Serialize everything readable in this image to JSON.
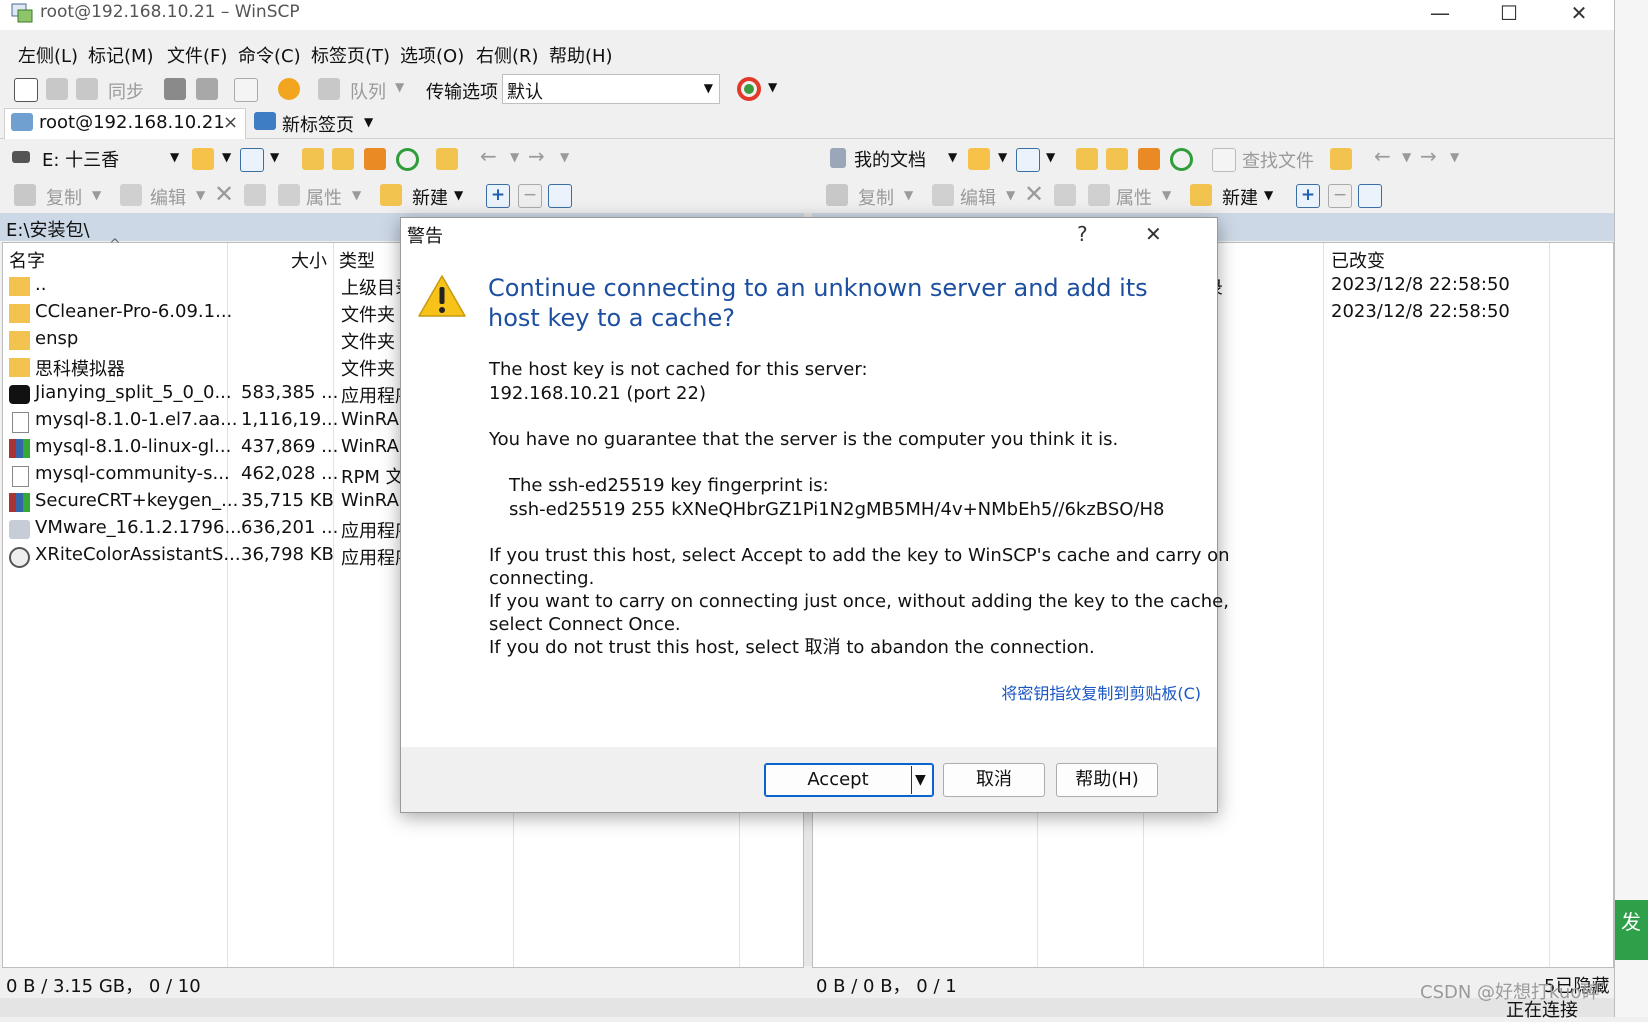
{
  "window": {
    "title": "root@192.168.10.21 – WinSCP",
    "minimize": "—",
    "maximize": "☐",
    "close": "✕"
  },
  "menu": [
    "左侧(L)",
    "标记(M)",
    "文件(F)",
    "命令(C)",
    "标签页(T)",
    "选项(O)",
    "右侧(R)",
    "帮助(H)"
  ],
  "toolbar": {
    "sync": "同步",
    "queue": "队列",
    "transfer_label": "传输选项",
    "transfer_value": "默认"
  },
  "tabs": {
    "session": "root@192.168.10.21",
    "session_close": "×",
    "new_tab": "新标签页"
  },
  "left_panel": {
    "drive": "E: 十三香",
    "actions": {
      "copy": "复制",
      "edit": "编辑",
      "properties": "属性",
      "new": "新建"
    },
    "path": "E:\\安装包\\",
    "columns": {
      "name": "名字",
      "size": "大小",
      "type": "类型"
    },
    "files": [
      {
        "name": "..",
        "size": "",
        "type": "上级目录",
        "icon": "parent-folder"
      },
      {
        "name": "CCleaner-Pro-6.09.1...",
        "size": "",
        "type": "文件夹",
        "icon": "folder"
      },
      {
        "name": "ensp",
        "size": "",
        "type": "文件夹",
        "icon": "folder"
      },
      {
        "name": "思科模拟器",
        "size": "",
        "type": "文件夹",
        "icon": "folder"
      },
      {
        "name": "Jianying_split_5_0_0...",
        "size": "583,385 ...",
        "type": "应用程序",
        "icon": "capcut"
      },
      {
        "name": "mysql-8.1.0-1.el7.aa...",
        "size": "1,116,19...",
        "type": "WinRAR",
        "icon": "file"
      },
      {
        "name": "mysql-8.1.0-linux-gl...",
        "size": "437,869 ...",
        "type": "WinRAR",
        "icon": "winrar"
      },
      {
        "name": "mysql-community-s...",
        "size": "462,028 ...",
        "type": "RPM 文",
        "icon": "file"
      },
      {
        "name": "SecureCRT+keygen_...",
        "size": "35,715 KB",
        "type": "WinRAR",
        "icon": "winrar"
      },
      {
        "name": "VMware_16.1.2.1796...",
        "size": "636,201 ...",
        "type": "应用程序",
        "icon": "vmware"
      },
      {
        "name": "XRiteColorAssistantS...",
        "size": "36,798 KB",
        "type": "应用程序",
        "icon": "xrite"
      }
    ],
    "status": "0 B / 3.15 GB， 0 / 10"
  },
  "right_panel": {
    "location": "我的文档",
    "find": "查找文件",
    "actions": {
      "copy": "复制",
      "edit": "编辑",
      "properties": "属性",
      "new": "新建"
    },
    "columns": {
      "changed": "已改变"
    },
    "partial_type": "录",
    "rows": [
      {
        "changed": "2023/12/8 22:58:50"
      },
      {
        "changed": "2023/12/8 22:58:50"
      }
    ],
    "status": "0 B / 0 B， 0 / 1",
    "hidden": "5已隐藏",
    "connecting": "正在连接"
  },
  "dialog": {
    "title": "警告",
    "help_icon": "?",
    "close_icon": "✕",
    "heading_line1": "Continue connecting to an unknown server and add its",
    "heading_line2": "host key to a cache?",
    "p1_line1": "The host key is not cached for this server:",
    "p1_line2": "192.168.10.21 (port 22)",
    "p2": "You have no guarantee that the server is the computer you think it is.",
    "fp_line1": "The ssh-ed25519 key fingerprint is:",
    "fp_line2": "ssh-ed25519 255 kXNeQHbrGZ1Pi1N2gMB5MH/4v+NMbEh5//6kzBSO/H8",
    "p3_line1": "If you trust this host, select Accept to add the key to WinSCP's cache and carry on",
    "p3_line2": "connecting.",
    "p3_line3": "If you want to carry on connecting just once, without adding the key to the cache,",
    "p3_line4": "select Connect Once.",
    "p3_line5": "If you do not trust this host, select 取消 to abandon the connection.",
    "copy_link": "将密钥指纹复制到剪贴板(C)",
    "accept": "Accept",
    "cancel": "取消",
    "help": "帮助(H)"
  },
  "watermark": "CSDN @好想打kuo碎",
  "side_text": "发"
}
